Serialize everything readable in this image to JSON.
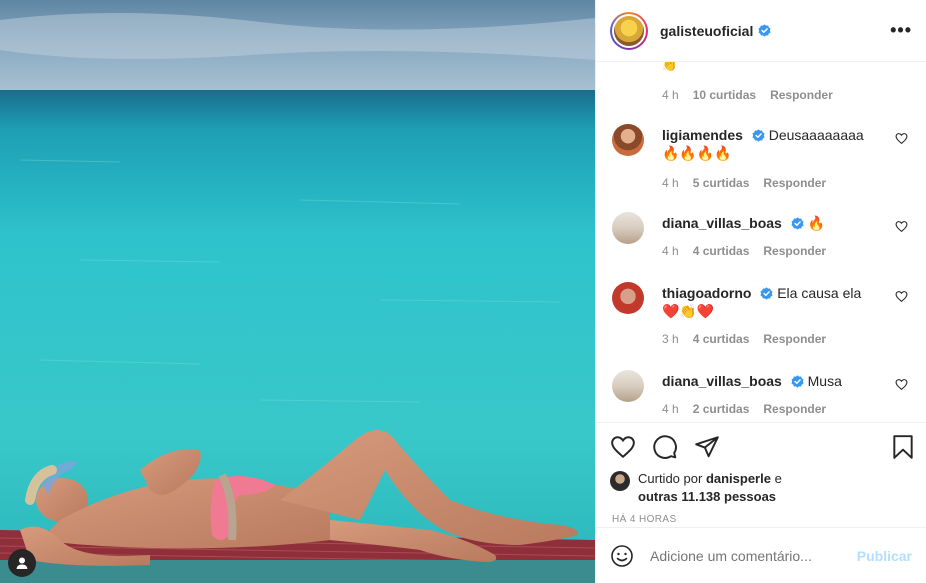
{
  "header": {
    "username": "galisteuoficial",
    "more_label": "•••"
  },
  "top_meta": {
    "time": "4 h",
    "likes": "10 curtidas",
    "reply": "Responder",
    "emoji": "👏"
  },
  "comments": [
    {
      "user": "ligiamendes",
      "text": "Deusaaaaaaaa🔥🔥🔥🔥",
      "time": "4 h",
      "likes": "5 curtidas",
      "reply": "Responder"
    },
    {
      "user": "diana_villas_boas",
      "text": "🔥",
      "time": "4 h",
      "likes": "4 curtidas",
      "reply": "Responder"
    },
    {
      "user": "thiagoadorno",
      "text": "Ela causa ela❤️👏❤️",
      "time": "3 h",
      "likes": "4 curtidas",
      "reply": "Responder"
    },
    {
      "user": "diana_villas_boas",
      "text": "Musa",
      "time": "4 h",
      "likes": "2 curtidas",
      "reply": "Responder"
    }
  ],
  "likes": {
    "prefix": "Curtido por",
    "user": "danisperle",
    "mid": "e",
    "others": "outras 11.138 pessoas"
  },
  "timestamp": "HÁ 4 HORAS",
  "add_comment": {
    "placeholder": "Adicione um comentário...",
    "publish_label": "Publicar"
  },
  "icons": [
    "verified-icon",
    "more-icon",
    "heart-icon",
    "comment-icon",
    "share-icon",
    "save-icon",
    "emoji-icon",
    "user-tag-icon"
  ],
  "colors": {
    "verified": "#3897f0",
    "publish": "#b2dffc",
    "muted": "#8e8e8e",
    "text": "#262626"
  }
}
